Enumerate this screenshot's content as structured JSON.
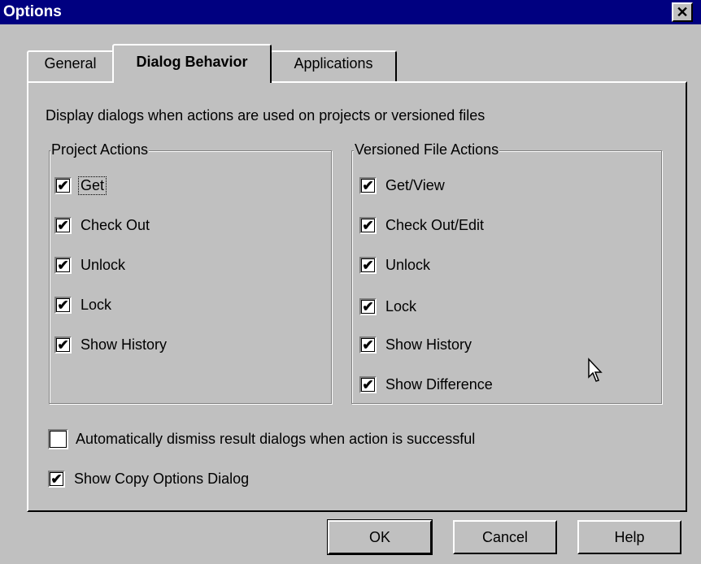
{
  "window": {
    "title": "Options",
    "close_icon": "close-icon"
  },
  "tabs": [
    {
      "label": "General"
    },
    {
      "label": "Dialog Behavior",
      "active": true
    },
    {
      "label": "Applications"
    }
  ],
  "description": "Display dialogs when actions are used on projects or versioned files",
  "project_actions": {
    "title": "Project Actions",
    "items": [
      {
        "label": "Get",
        "checked": true
      },
      {
        "label": "Check Out",
        "checked": true
      },
      {
        "label": "Unlock",
        "checked": true
      },
      {
        "label": "Lock",
        "checked": true
      },
      {
        "label": "Show History",
        "checked": true
      }
    ]
  },
  "versioned_file_actions": {
    "title": "Versioned File Actions",
    "items": [
      {
        "label": "Get/View",
        "checked": true
      },
      {
        "label": "Check Out/Edit",
        "checked": true
      },
      {
        "label": "Unlock",
        "checked": true
      },
      {
        "label": "Lock",
        "checked": true
      },
      {
        "label": "Show History",
        "checked": true
      },
      {
        "label": "Show Difference",
        "checked": true
      }
    ]
  },
  "options": {
    "auto_dismiss": {
      "label": "Automatically dismiss result dialogs when action is successful",
      "checked": false
    },
    "show_copy": {
      "label": "Show Copy Options Dialog",
      "checked": true
    }
  },
  "buttons": {
    "ok": "OK",
    "cancel": "Cancel",
    "help": "Help"
  },
  "colors": {
    "titlebar": "#000080",
    "face": "#c0c0c0"
  }
}
